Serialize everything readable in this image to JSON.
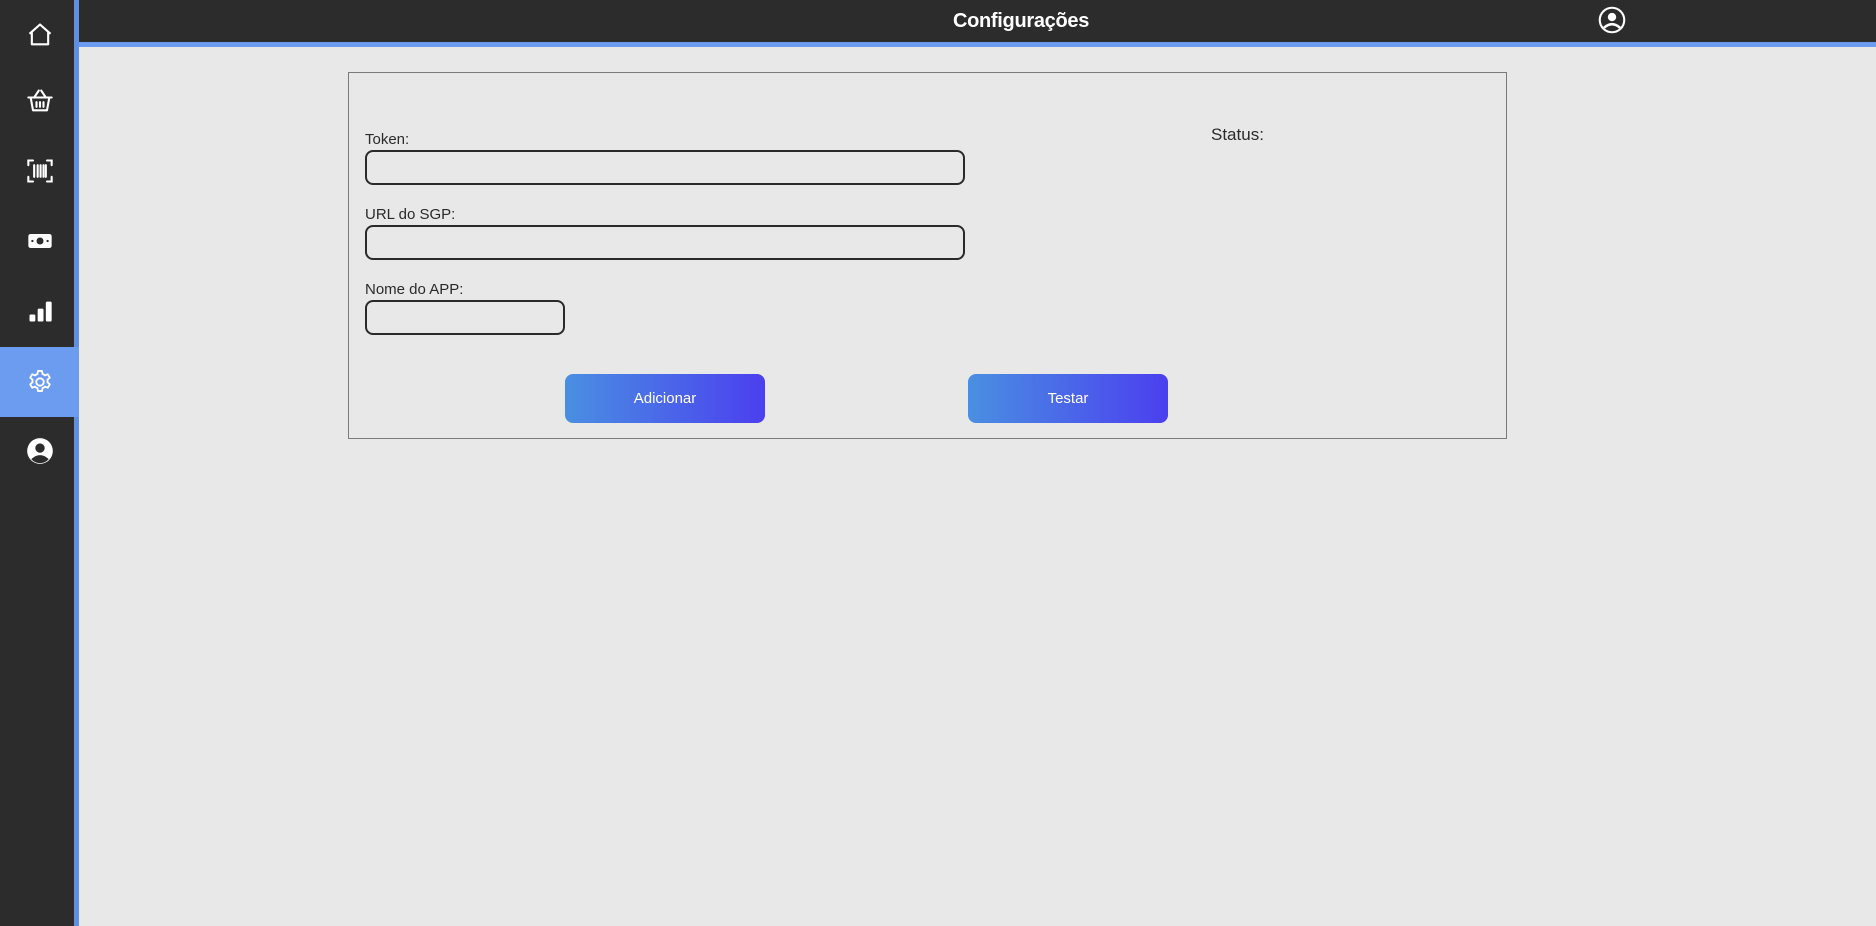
{
  "header": {
    "title": "Configurações",
    "user_icon": "user-circle-icon"
  },
  "sidebar": {
    "accent_color": "#6c9cf0",
    "items": [
      {
        "name": "home",
        "icon": "home-icon",
        "active": false
      },
      {
        "name": "basket",
        "icon": "basket-icon",
        "active": false
      },
      {
        "name": "barcode",
        "icon": "barcode-scan-icon",
        "active": false
      },
      {
        "name": "cash",
        "icon": "cash-icon",
        "active": false
      },
      {
        "name": "reports",
        "icon": "bar-chart-icon",
        "active": false
      },
      {
        "name": "settings",
        "icon": "gear-icon",
        "active": true
      },
      {
        "name": "profile",
        "icon": "user-circle-icon",
        "active": false
      }
    ]
  },
  "form": {
    "token": {
      "label": "Token:",
      "value": "",
      "placeholder": ""
    },
    "sgp_url": {
      "label": "URL do SGP:",
      "value": "",
      "placeholder": ""
    },
    "app_name": {
      "label": "Nome do APP:",
      "value": "",
      "placeholder": ""
    },
    "status_label": "Status:",
    "add_button": "Adicionar",
    "test_button": "Testar",
    "button_gradient": [
      "#4a8fe2",
      "#4b3fef"
    ]
  }
}
